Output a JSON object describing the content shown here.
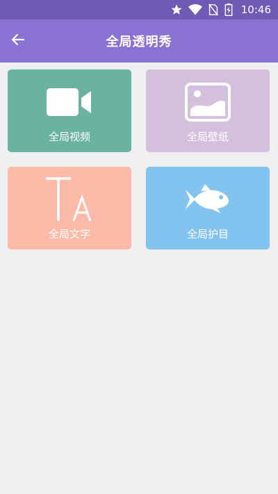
{
  "status_bar": {
    "time": "10:46",
    "icons": [
      "star-icon",
      "wifi-icon",
      "no-sim-icon",
      "battery-charging-icon"
    ],
    "background": "#6f5bb5"
  },
  "app_bar": {
    "title": "全局透明秀",
    "back_icon": "arrow-left-icon",
    "background": "#8a72d3"
  },
  "tiles": [
    {
      "label": "全局视频",
      "icon": "video-camera-icon",
      "color": "#6ab3a0"
    },
    {
      "label": "全局壁纸",
      "icon": "image-icon",
      "color": "#d4bfdd"
    },
    {
      "label": "全局文字",
      "icon": "text-icon",
      "color": "#fdbaa8"
    },
    {
      "label": "全局护目",
      "icon": "fish-icon",
      "color": "#82c3ef"
    }
  ]
}
